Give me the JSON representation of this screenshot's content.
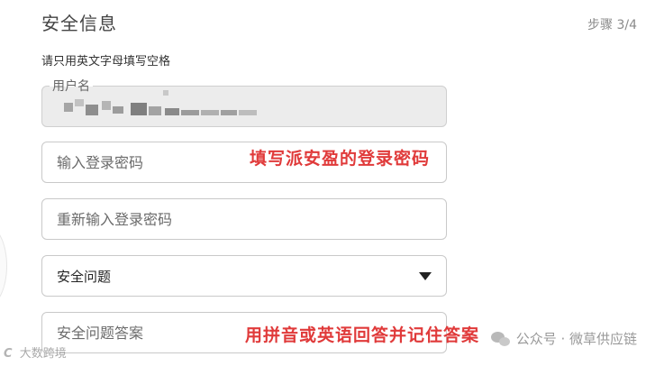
{
  "header": {
    "title": "安全信息",
    "step": "步骤 3/4"
  },
  "hint": "请只用英文字母填写空格",
  "form": {
    "username": {
      "label": "用户名"
    },
    "password": {
      "placeholder": "输入登录密码"
    },
    "confirm_password": {
      "placeholder": "重新输入登录密码"
    },
    "security_question": {
      "selected": "安全问题"
    },
    "security_answer": {
      "placeholder": "安全问题答案"
    }
  },
  "annotations": {
    "password_note": "填写派安盈的登录密码",
    "answer_note": "用拼音或英语回答并记住答案"
  },
  "watermarks": {
    "left_mark": "C",
    "left_text": "大数跨境",
    "right_text": "公众号 · 微草供应链"
  },
  "colors": {
    "annotation": "#e03a3a",
    "border": "#c9c9c9",
    "disabled_bg": "#ececec"
  },
  "icons": {
    "dropdown": "caret-down-icon",
    "wechat": "wechat-icon"
  }
}
